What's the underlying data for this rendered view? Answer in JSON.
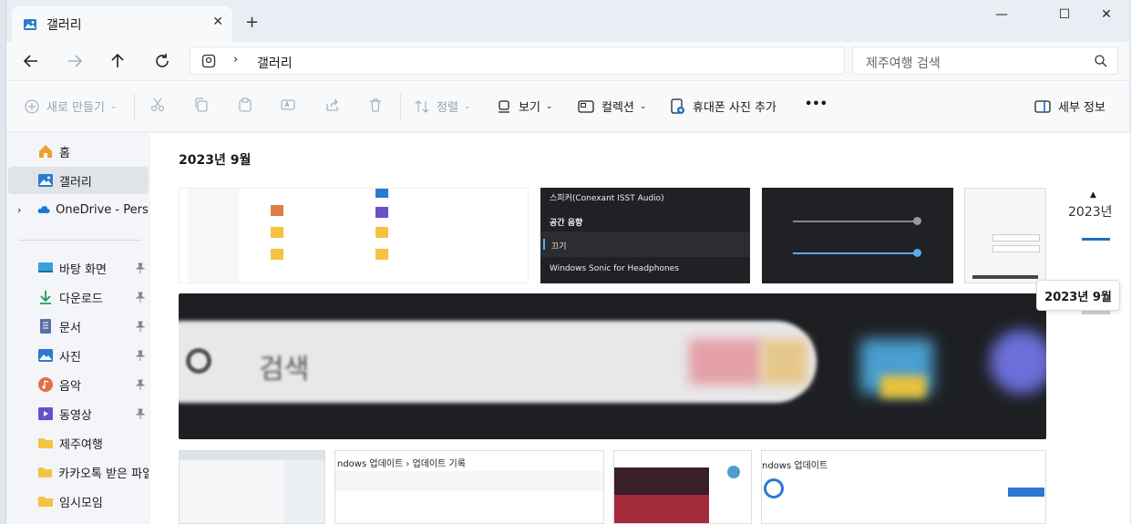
{
  "tab": {
    "title": "갤러리",
    "close": "✕",
    "new": "+"
  },
  "window": {
    "minimize": "—",
    "maximize": "☐",
    "close": "✕"
  },
  "nav": {
    "breadcrumb": "갤러리",
    "chevron": "›"
  },
  "search": {
    "placeholder": "제주여행 검색"
  },
  "toolbar": {
    "new_label": "새로 만들기",
    "sort_label": "정렬",
    "view_label": "보기",
    "collection_label": "컬렉션",
    "add_phone_label": "휴대폰 사진 추가",
    "more_label": "•••",
    "details_label": "세부 정보"
  },
  "sidebar": {
    "items": [
      {
        "label": "홈"
      },
      {
        "label": "갤러리"
      },
      {
        "label": "OneDrive - Personal"
      },
      {
        "label": "바탕 화면"
      },
      {
        "label": "다운로드"
      },
      {
        "label": "문서"
      },
      {
        "label": "사진"
      },
      {
        "label": "음악"
      },
      {
        "label": "동영상"
      },
      {
        "label": "제주여행"
      },
      {
        "label": "카카오톡 받은 파일"
      },
      {
        "label": "임시모임"
      }
    ]
  },
  "gallery": {
    "month_header": "2023년 9월",
    "audio_panel": {
      "speaker": "스피커(Conexant ISST Audio)",
      "spatial": "공간 음향",
      "off": "끄기",
      "sonic": "Windows Sonic for Headphones"
    },
    "update_history": "ndows 업데이트 › 업데이트 기록",
    "update_title": "ndows 업데이트",
    "search_blur": "검색"
  },
  "timeline": {
    "year": "2023년",
    "tooltip": "2023년 9월"
  },
  "colors": {
    "accent": "#1a6fc7",
    "selected_bg": "#e0e4e9"
  }
}
